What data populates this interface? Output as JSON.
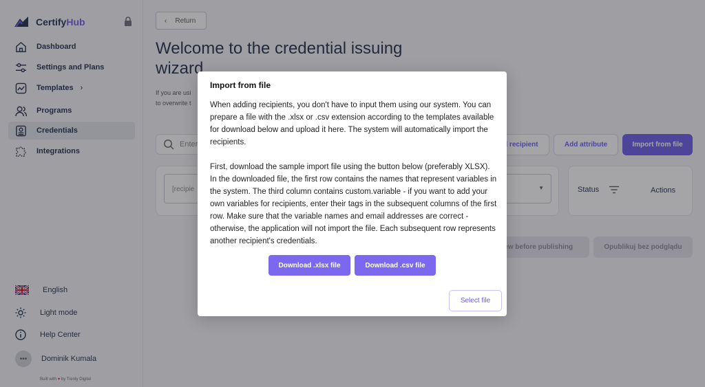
{
  "app": {
    "name_prefix": "Certify",
    "name_accent": "Hub",
    "accent_color": "#6a5ae8"
  },
  "sidebar": {
    "items": [
      {
        "label": "Dashboard",
        "icon": "home-icon"
      },
      {
        "label": "Settings and Plans",
        "icon": "sliders-icon"
      },
      {
        "label": "Templates",
        "icon": "chart-icon"
      },
      {
        "label": "Programs",
        "icon": "users-icon"
      },
      {
        "label": "Credentials",
        "icon": "certificate-icon"
      },
      {
        "label": "Integrations",
        "icon": "puzzle-icon"
      }
    ],
    "language": "English",
    "theme": "Light mode",
    "help": "Help Center",
    "user": "Dominik Kumala",
    "avatar_text": "•••",
    "built_prefix": "Built with",
    "built_suffix": "by Trenty Digital"
  },
  "main": {
    "return_label": "Return",
    "title": "Welcome to the credential issuing wizard",
    "intro_line1": "If you are usi",
    "intro_line2": "to overwrite t",
    "search_placeholder": "Enter",
    "add_recipient": "l recipient",
    "add_attribute": "Add attribute",
    "import_file": "Import from file",
    "recipient_field": "[recipie",
    "status_label": "Status",
    "actions_label": "Actions",
    "preview_button": "view before publishing",
    "publish_button": "Opublikuj bez podglądu"
  },
  "modal": {
    "title": "Import from file",
    "paragraph1": "When adding recipients, you don't have to input them using our system. You can prepare a file with the .xlsx or .csv extension according to the templates available for download below and upload it here. The system will automatically import the recipients.",
    "paragraph2": "First, download the sample import file using the button below (preferably XLSX). In the downloaded file, the first row contains the names that represent variables in the system. The third column contains custom.variable - if you want to add your own variables for recipients, enter their tags in the subsequent columns of the first row. Make sure that the variable names and email addresses are correct - otherwise, the application will not import the file. Each subsequent row represents another recipient's credentials.",
    "download_xlsx": "Download .xlsx file",
    "download_csv": "Download .csv file",
    "select_file": "Select file"
  }
}
